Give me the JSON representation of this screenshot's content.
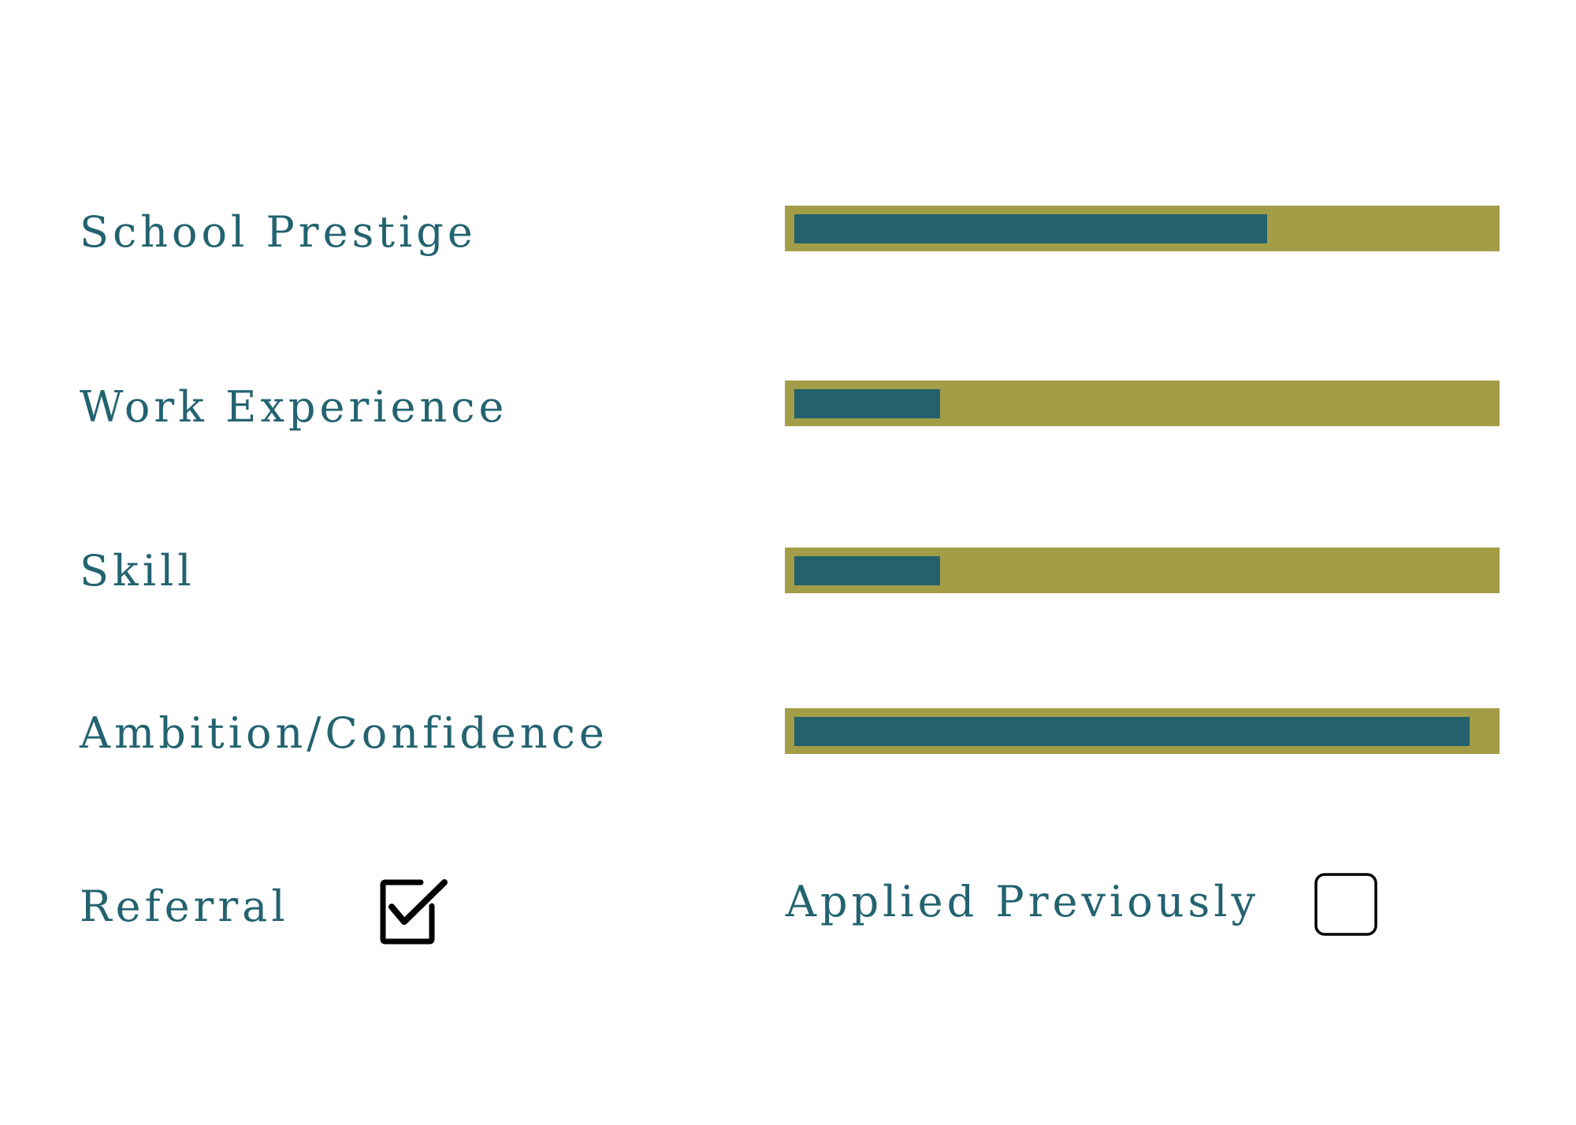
{
  "colors": {
    "label_text": "#236370",
    "track": "#a39d48",
    "fill": "#23626d",
    "checkbox_stroke": "#000000"
  },
  "rows": [
    {
      "label": "School Prestige",
      "value": 0.68
    },
    {
      "label": "Work Experience",
      "value": 0.21
    },
    {
      "label": "Skill",
      "value": 0.21
    },
    {
      "label": "Ambition/Confidence",
      "value": 0.97
    }
  ],
  "checks": {
    "referral": {
      "label": "Referral",
      "checked": true,
      "icon": "checkbox-checked-icon"
    },
    "applied_previously": {
      "label": "Applied Previously",
      "checked": false,
      "icon": "checkbox-empty-icon"
    }
  }
}
